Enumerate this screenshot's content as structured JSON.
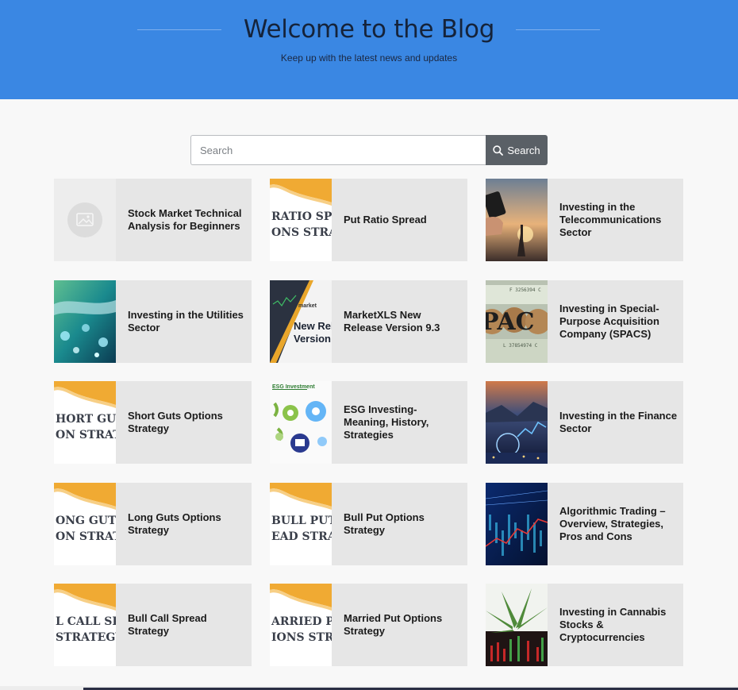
{
  "hero": {
    "title": "Welcome to the Blog",
    "subtitle": "Keep up with the latest news and updates",
    "background": "#3a87e3"
  },
  "search": {
    "placeholder": "Search",
    "value": "",
    "button_label": "Search",
    "button_icon": "search-icon"
  },
  "posts": [
    {
      "title": "Stock Market Technical Analysis for Beginners",
      "thumb": "placeholder-image",
      "thumb_text": ""
    },
    {
      "title": "Put Ratio Spread",
      "thumb": "banner",
      "thumb_text": "RATIO SPR\nONS STRAT"
    },
    {
      "title": "Investing in the Telecommunications Sector",
      "thumb": "photo-telecom",
      "thumb_text": ""
    },
    {
      "title": "Investing in the Utilities Sector",
      "thumb": "photo-utilities",
      "thumb_text": ""
    },
    {
      "title": "MarketXLS New Release Version 9.3",
      "thumb": "banner-release",
      "thumb_text": "New Rel\nVersion"
    },
    {
      "title": "Investing in Special-Purpose Acquisition Company (SPACS)",
      "thumb": "photo-spac",
      "thumb_text": "PAC"
    },
    {
      "title": "Short Guts Options Strategy",
      "thumb": "banner",
      "thumb_text": "HORT GUTS\nON STRAT"
    },
    {
      "title": "ESG Investing- Meaning, History, Strategies",
      "thumb": "esg",
      "thumb_text": "ESG Investment"
    },
    {
      "title": "Investing in the Finance Sector",
      "thumb": "photo-city",
      "thumb_text": ""
    },
    {
      "title": "Long Guts Options Strategy",
      "thumb": "banner",
      "thumb_text": "ONG GUT\nON STRAT"
    },
    {
      "title": "Bull Put Options Strategy",
      "thumb": "banner",
      "thumb_text": "BULL PUT\nEAD STRA"
    },
    {
      "title": "Algorithmic Trading – Overview, Strategies, Pros and Cons",
      "thumb": "photo-algo",
      "thumb_text": ""
    },
    {
      "title": "Bull Call Spread Strategy",
      "thumb": "banner",
      "thumb_text": "L CALL SPR\nSTRATEGY"
    },
    {
      "title": "Married Put Options Strategy",
      "thumb": "banner",
      "thumb_text": "ARRIED PUT\nIONS STRAT"
    },
    {
      "title": "Investing in Cannabis Stocks & Cryptocurrencies",
      "thumb": "photo-cannabis",
      "thumb_text": ""
    }
  ]
}
